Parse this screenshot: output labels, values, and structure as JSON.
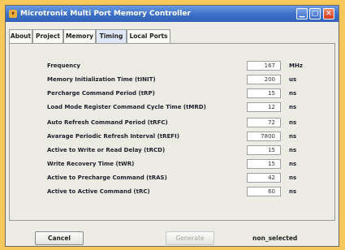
{
  "window": {
    "title": "Microtronix Multi Port Memory Controller"
  },
  "tabs": [
    {
      "label": "About"
    },
    {
      "label": "Project"
    },
    {
      "label": "Memory"
    },
    {
      "label": "Timing"
    },
    {
      "label": "Local Ports"
    }
  ],
  "rows": [
    {
      "label": "Frequency",
      "value": "167",
      "unit": "MHz"
    },
    {
      "label": "Memory Initialization Time (tINIT)",
      "value": "200",
      "unit": "us"
    },
    {
      "label": "Percharge Command Period (tRP)",
      "value": "15",
      "unit": "ns"
    },
    {
      "label": "Load Mode Register Command Cycle Time (tMRD)",
      "value": "12",
      "unit": "ns"
    },
    {
      "label": "Auto Refresh Command Period (tRFC)",
      "value": "72",
      "unit": "ns"
    },
    {
      "label": "Avarage Periodic Refresh Interval (tREFI)",
      "value": "7800",
      "unit": "ns"
    },
    {
      "label": "Active to Write or Read Delay (tRCD)",
      "value": "15",
      "unit": "ns"
    },
    {
      "label": "Write Recovery Time (tWR)",
      "value": "15",
      "unit": "ns"
    },
    {
      "label": "Active to Precharge Command (tRAS)",
      "value": "42",
      "unit": "ns"
    },
    {
      "label": "Active to Active Command (tRC)",
      "value": "60",
      "unit": "ns"
    }
  ],
  "footer": {
    "cancel": "Cancel",
    "generate": "Generate",
    "status": "non_selected"
  }
}
